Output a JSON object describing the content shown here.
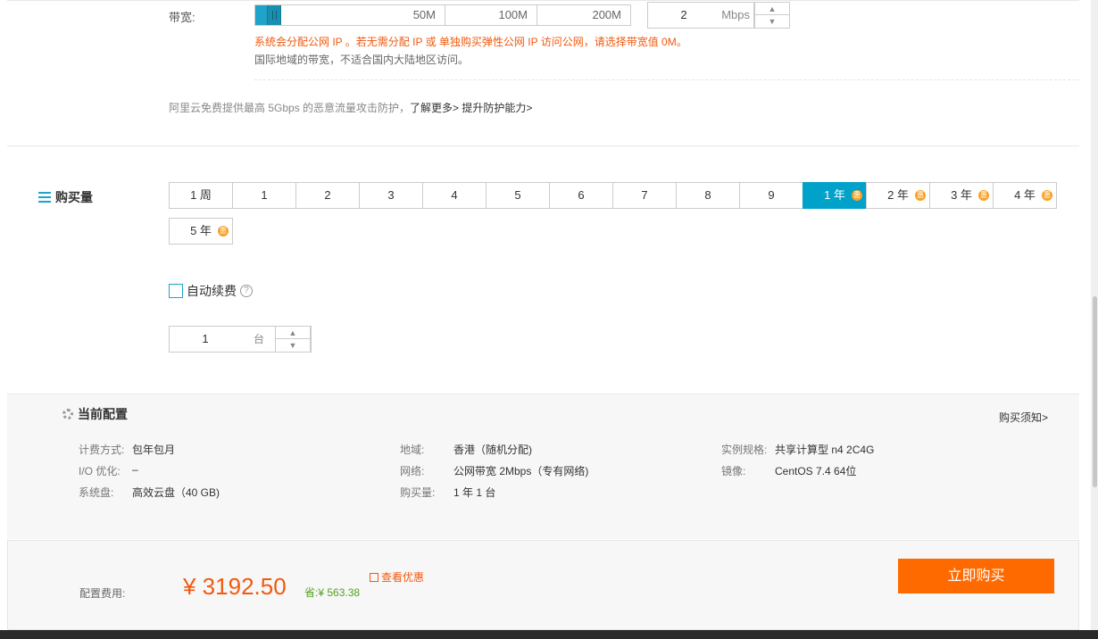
{
  "bandwidth": {
    "label": "带宽:",
    "ticks": [
      "50M",
      "100M",
      "200M"
    ],
    "value": "2",
    "unit": "Mbps",
    "fill_fraction": 0.07,
    "note_orange": "系统会分配公网 IP 。若无需分配 IP 或 单独购买弹性公网 IP 访问公网，请选择带宽值 0M。",
    "note_gray": "国际地域的带宽，不适合国内大陆地区访问。",
    "ddos_text": "阿里云免费提供最高 5Gbps 的恶意流量攻击防护，",
    "ddos_link1": "了解更多>",
    "ddos_link2": "提升防护能力>"
  },
  "purchase": {
    "title": "购买量",
    "durations": [
      {
        "label": "1 周",
        "badge": false
      },
      {
        "label": "1",
        "badge": false
      },
      {
        "label": "2",
        "badge": false
      },
      {
        "label": "3",
        "badge": false
      },
      {
        "label": "4",
        "badge": false
      },
      {
        "label": "5",
        "badge": false
      },
      {
        "label": "6",
        "badge": false
      },
      {
        "label": "7",
        "badge": false
      },
      {
        "label": "8",
        "badge": false
      },
      {
        "label": "9",
        "badge": false
      },
      {
        "label": "1 年",
        "badge": true,
        "selected": true
      },
      {
        "label": "2 年",
        "badge": true
      },
      {
        "label": "3 年",
        "badge": true
      },
      {
        "label": "4 年",
        "badge": true
      },
      {
        "label": "5 年",
        "badge": true
      }
    ],
    "badge_char": "惠",
    "auto_renew_label": "自动续费",
    "help_char": "?",
    "qty_value": "1",
    "qty_unit": "台"
  },
  "config": {
    "title": "当前配置",
    "notice_link": "购买须知>",
    "rows": {
      "billing": {
        "k": "计费方式:",
        "v": "包年包月"
      },
      "io": {
        "k": "I/O 优化:",
        "v": "–"
      },
      "disk": {
        "k": "系统盘:",
        "v": "高效云盘（40 GB)"
      },
      "region": {
        "k": "地域:",
        "v": "香港（随机分配)"
      },
      "network": {
        "k": "网络:",
        "v": "公网带宽 2Mbps（专有网络)"
      },
      "amount": {
        "k": "购买量:",
        "v": "1 年 1 台"
      },
      "spec": {
        "k": "实例规格:",
        "v": "共享计算型 n4 2C4G"
      },
      "image": {
        "k": "镜像:",
        "v": "CentOS 7.4 64位"
      }
    }
  },
  "footer": {
    "fee_label": "配置费用:",
    "price": "¥ 3192.50",
    "save": "省:¥ 563.38",
    "offer": "查看优惠",
    "buy_button": "立即购买"
  },
  "colors": {
    "accent": "#00a2ca",
    "orange": "#ff6a00",
    "green": "#52a21f"
  }
}
